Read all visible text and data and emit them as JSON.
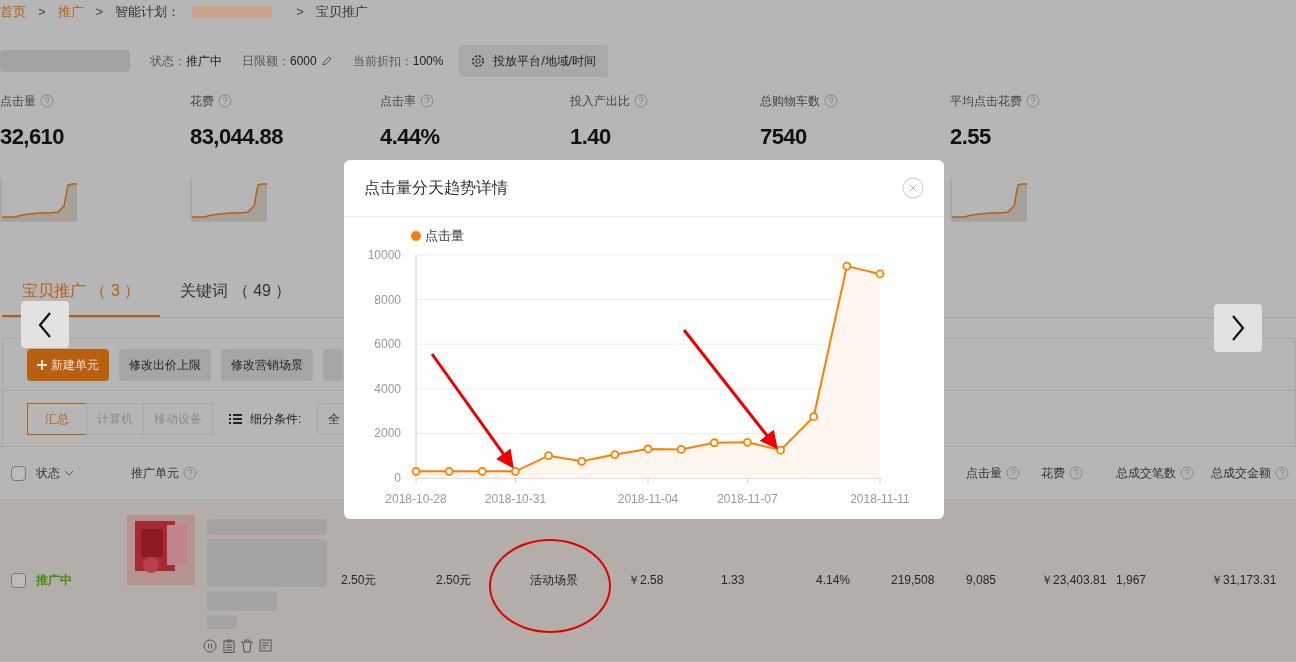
{
  "breadcrumb": [
    {
      "kind": "link",
      "label": "首页"
    },
    {
      "kind": "separator",
      "label": ">"
    },
    {
      "kind": "link",
      "label": "推广"
    },
    {
      "kind": "separator",
      "label": ">"
    },
    {
      "kind": "text",
      "label": "智能计划："
    },
    {
      "kind": "redacted"
    },
    {
      "kind": "separator",
      "label": ">"
    },
    {
      "kind": "text",
      "label": "宝贝推广"
    }
  ],
  "plan": {
    "status_label": "状态：",
    "status": "推广中",
    "budget_label": "日限额：",
    "budget": "6000",
    "discount_label": "当前折扣：",
    "discount": "100%",
    "settings_button": "投放平台/地域/时间"
  },
  "metrics": [
    {
      "label": "点击量",
      "value": "32,610",
      "sparkline": true
    },
    {
      "label": "花费",
      "value": "83,044.88",
      "sparkline": true
    },
    {
      "label": "点击率",
      "value": "4.44%"
    },
    {
      "label": "投入产出比",
      "value": "1.40"
    },
    {
      "label": "总购物车数",
      "value": "7540"
    },
    {
      "label": "平均点击花费",
      "value": "2.55",
      "sparkline": true
    }
  ],
  "tabs": [
    {
      "label": "宝贝推广 （ 3 ）",
      "selected": true
    },
    {
      "label": "关键词 （ 49 ）",
      "selected": false
    }
  ],
  "toolbar": [
    {
      "label": "新建单元",
      "kind": "primary"
    },
    {
      "label": "修改出价上限",
      "kind": "plain"
    },
    {
      "label": "修改营销场景",
      "kind": "plain"
    },
    {
      "kind": "plain"
    }
  ],
  "segments": [
    {
      "label": "汇总",
      "selected": true
    },
    {
      "label": "计算机",
      "selected": false
    },
    {
      "label": "移动设备",
      "selected": false
    }
  ],
  "filter": {
    "label": "细分条件:",
    "value": "全"
  },
  "table": {
    "all_checked": false,
    "columns": [
      "状态",
      "推广单元",
      "",
      "",
      "",
      "",
      "",
      "",
      "",
      "点击量",
      "花费",
      "总成交笔数",
      "总成交金额"
    ],
    "rows": [
      {
        "checked": false,
        "cells": [
          "推广中",
          "",
          "2.50元",
          "2.50元",
          "活动场景",
          "￥2.58",
          "1.33",
          "4.14%",
          "219,508",
          "9,085",
          "￥23,403.81",
          "1,967",
          "￥31,173.31"
        ]
      }
    ]
  },
  "modal": {
    "title": "点击量分天趋势详情",
    "chart_data": {
      "type": "area",
      "grid": true,
      "categories": [
        "2018-10-28",
        null,
        null,
        "2018-10-31",
        null,
        null,
        null,
        "2018-11-04",
        null,
        null,
        "2018-11-07",
        null,
        null,
        null,
        "2018-11-11"
      ],
      "series": [
        {
          "name": "点击量",
          "color": "#ff8000",
          "marker": "circle",
          "values": [
            300,
            300,
            300,
            300,
            1000,
            750,
            1050,
            1300,
            1280,
            1580,
            1600,
            1250,
            2750,
            9500,
            9150
          ]
        }
      ],
      "ylim": [
        0,
        10000
      ],
      "yticks": [
        0,
        2000,
        4000,
        6000,
        8000,
        10000
      ]
    }
  }
}
